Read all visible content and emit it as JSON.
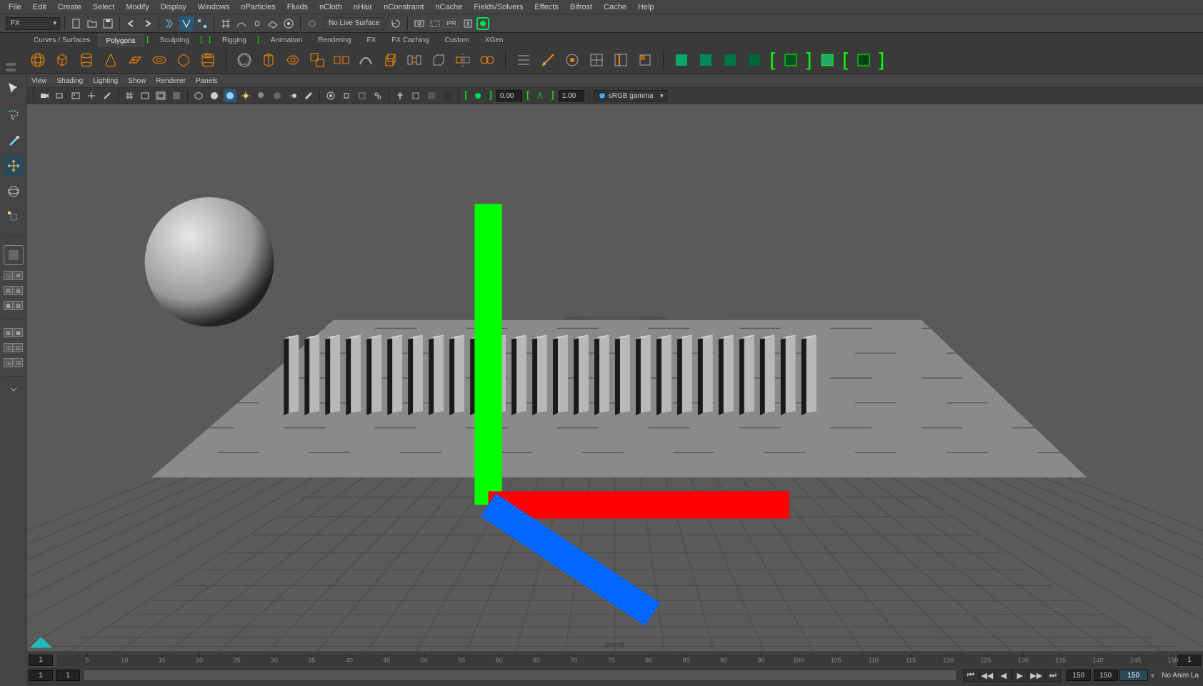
{
  "menus": [
    "File",
    "Edit",
    "Create",
    "Select",
    "Modify",
    "Display",
    "Windows",
    "nParticles",
    "Fluids",
    "nCloth",
    "nHair",
    "nConstraint",
    "nCache",
    "Fields/Solvers",
    "Effects",
    "Bifrost",
    "Cache",
    "Help"
  ],
  "fx_mode": "FX",
  "no_live_surface": "No Live Surface",
  "shelf_tabs": [
    "Curves / Surfaces",
    "Polygons",
    "Sculpting",
    "Rigging",
    "Animation",
    "Rendering",
    "FX",
    "FX Caching",
    "Custom",
    "XGen"
  ],
  "shelf_active": "Polygons",
  "shelf_brackets": [
    "Sculpting",
    "Rigging"
  ],
  "panel_menus": [
    "View",
    "Shading",
    "Lighting",
    "Show",
    "Renderer",
    "Panels"
  ],
  "exposure": "0.00",
  "gamma": "1.00",
  "color_transform": "sRGB gamma",
  "panel_name": "persp",
  "timeline": {
    "start": "1",
    "display_start": "1",
    "current": "1",
    "display_end": "150",
    "end": "150",
    "end_edit": "150"
  },
  "anim_layer": "No Anim La",
  "ruler_step": 5,
  "ruler_min": 5,
  "ruler_max": 150
}
